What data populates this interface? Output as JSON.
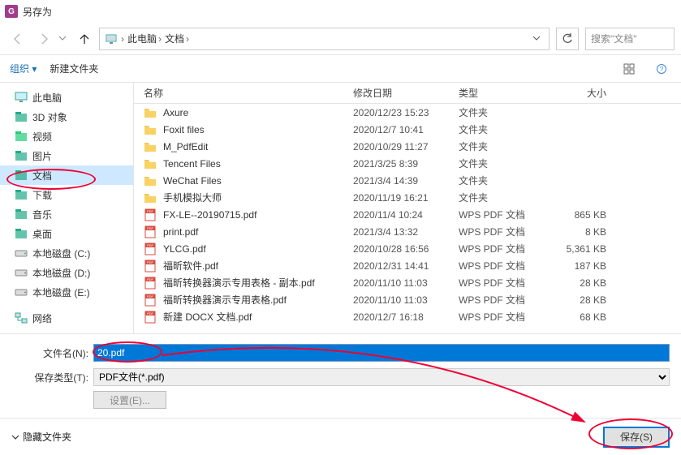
{
  "window": {
    "title": "另存为"
  },
  "breadcrumb": {
    "root": "此电脑",
    "folder": "文档"
  },
  "search": {
    "placeholder": "搜索\"文档\""
  },
  "cmdbar": {
    "organize": "组织 ▾",
    "new_folder": "新建文件夹"
  },
  "sidebar": {
    "items": [
      {
        "label": "此电脑",
        "icon": "monitor",
        "color": "#2c7"
      },
      {
        "label": "3D 对象",
        "icon": "cube",
        "color": "#2a8"
      },
      {
        "label": "视频",
        "icon": "video",
        "color": "#2c7"
      },
      {
        "label": "图片",
        "icon": "picture",
        "color": "#2a8"
      },
      {
        "label": "文档",
        "icon": "doc",
        "color": "#2a8",
        "selected": true
      },
      {
        "label": "下载",
        "icon": "download",
        "color": "#2a8"
      },
      {
        "label": "音乐",
        "icon": "music",
        "color": "#2a8"
      },
      {
        "label": "桌面",
        "icon": "desktop",
        "color": "#2a8"
      },
      {
        "label": "本地磁盘 (C:)",
        "icon": "drive",
        "color": "#5a7"
      },
      {
        "label": "本地磁盘 (D:)",
        "icon": "drive",
        "color": "#888"
      },
      {
        "label": "本地磁盘 (E:)",
        "icon": "drive",
        "color": "#888"
      }
    ],
    "network": "网络"
  },
  "columns": {
    "name": "名称",
    "date": "修改日期",
    "type": "类型",
    "size": "大小"
  },
  "files": [
    {
      "name": "Axure",
      "date": "2020/12/23 15:23",
      "type": "文件夹",
      "size": "",
      "kind": "folder"
    },
    {
      "name": "Foxit files",
      "date": "2020/12/7 10:41",
      "type": "文件夹",
      "size": "",
      "kind": "folder"
    },
    {
      "name": "M_PdfEdit",
      "date": "2020/10/29 11:27",
      "type": "文件夹",
      "size": "",
      "kind": "folder"
    },
    {
      "name": "Tencent Files",
      "date": "2021/3/25 8:39",
      "type": "文件夹",
      "size": "",
      "kind": "folder"
    },
    {
      "name": "WeChat Files",
      "date": "2021/3/4 14:39",
      "type": "文件夹",
      "size": "",
      "kind": "folder"
    },
    {
      "name": "手机模拟大师",
      "date": "2020/11/19 16:21",
      "type": "文件夹",
      "size": "",
      "kind": "folder"
    },
    {
      "name": "FX-LE--20190715.pdf",
      "date": "2020/11/4 10:24",
      "type": "WPS PDF 文档",
      "size": "865 KB",
      "kind": "pdf"
    },
    {
      "name": "print.pdf",
      "date": "2021/3/4 13:32",
      "type": "WPS PDF 文档",
      "size": "8 KB",
      "kind": "pdf"
    },
    {
      "name": "YLCG.pdf",
      "date": "2020/10/28 16:56",
      "type": "WPS PDF 文档",
      "size": "5,361 KB",
      "kind": "pdf"
    },
    {
      "name": "福昕软件.pdf",
      "date": "2020/12/31 14:41",
      "type": "WPS PDF 文档",
      "size": "187 KB",
      "kind": "pdf"
    },
    {
      "name": "福昕转换器演示专用表格 - 副本.pdf",
      "date": "2020/11/10 11:03",
      "type": "WPS PDF 文档",
      "size": "28 KB",
      "kind": "pdf"
    },
    {
      "name": "福昕转换器演示专用表格.pdf",
      "date": "2020/11/10 11:03",
      "type": "WPS PDF 文档",
      "size": "28 KB",
      "kind": "pdf"
    },
    {
      "name": "新建 DOCX 文档.pdf",
      "date": "2020/12/7 16:18",
      "type": "WPS PDF 文档",
      "size": "68 KB",
      "kind": "pdf"
    }
  ],
  "form": {
    "filename_label": "文件名(N):",
    "filename_value": "20.pdf",
    "filetype_label": "保存类型(T):",
    "filetype_value": "PDF文件(*.pdf)",
    "settings_label": "设置(E)..."
  },
  "footer": {
    "hide_folders": "隐藏文件夹",
    "save": "保存(S)"
  }
}
